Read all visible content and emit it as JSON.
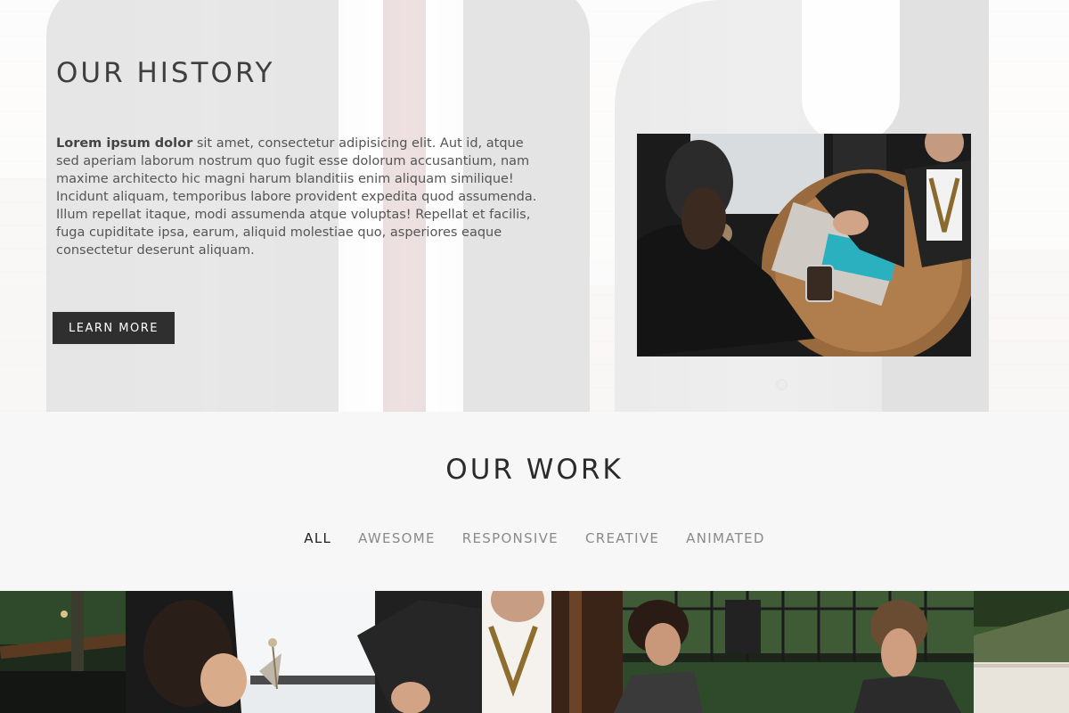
{
  "history": {
    "title": "OUR HISTORY",
    "text_bold": "Lorem ipsum dolor",
    "text_rest": " sit amet, consectetur adipisicing elit. Aut id, atque sed aperiam laborum nostrum quo fugit esse dolorum accusantium, nam maxime architecto hic magni harum blanditiis enim aliquam similique! Incidunt aliquam, temporibus labore provident expedita quod assumenda. Illum repellat itaque, modi assumenda atque voluptas! Repellat et facilis, fuga cupiditate ipsa, earum, aliquid molestiae quo, asperiores eaque consectetur deserunt aliquam.",
    "button_label": "LEARN MORE"
  },
  "work": {
    "title": "OUR WORK",
    "filters": [
      {
        "label": "ALL",
        "active": true
      },
      {
        "label": "AWESOME",
        "active": false
      },
      {
        "label": "RESPONSIVE",
        "active": false
      },
      {
        "label": "CREATIVE",
        "active": false
      },
      {
        "label": "ANIMATED",
        "active": false
      }
    ]
  },
  "colors": {
    "button_bg": "#2f2f2f",
    "active_filter": "#222222",
    "inactive_filter": "#8a8a8a",
    "section_bg": "#f7f7f7"
  }
}
